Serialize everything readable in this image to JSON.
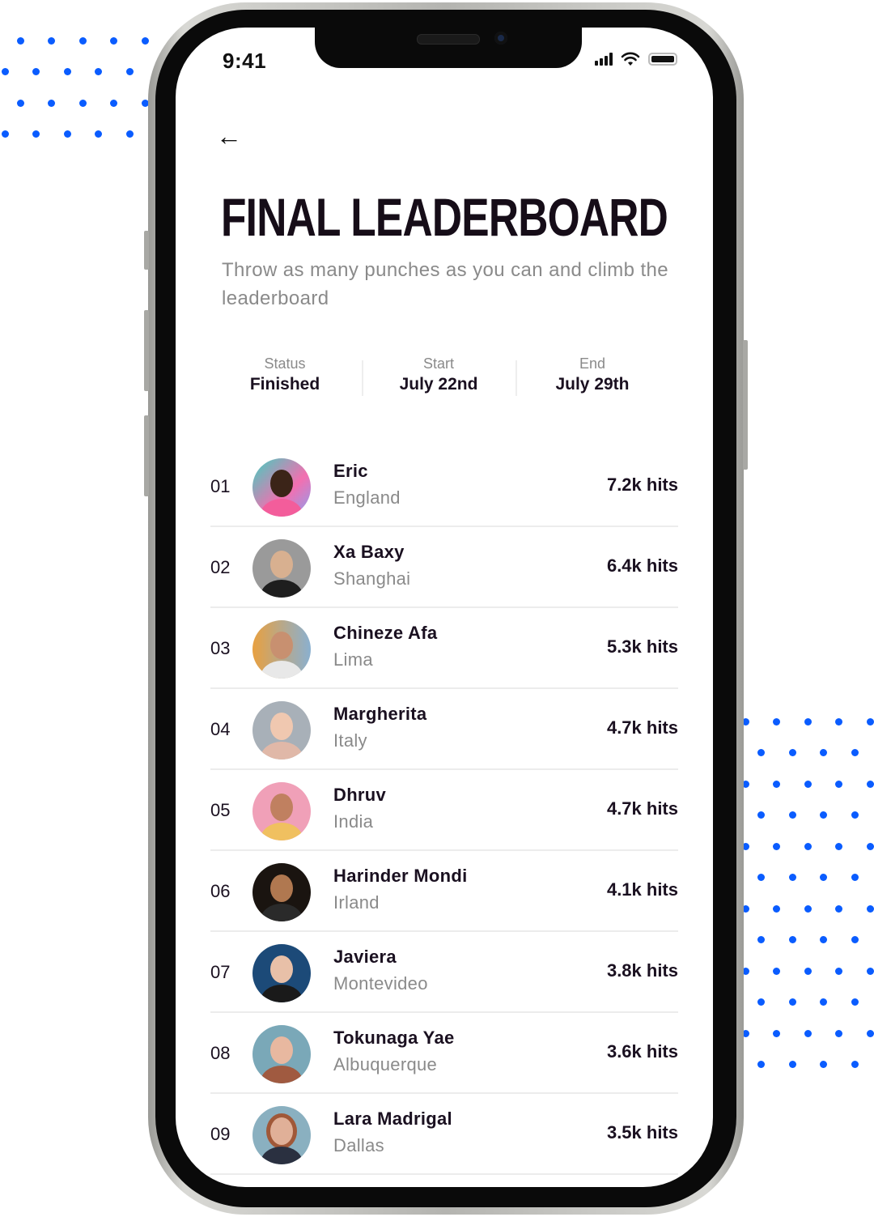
{
  "status_bar": {
    "time": "9:41"
  },
  "header": {
    "back_icon": "arrow-left-icon",
    "title": "FINAL LEADERBOARD",
    "subtitle": "Throw as many punches as you can and climb the leaderboard"
  },
  "meta": [
    {
      "label": "Status",
      "value": "Finished"
    },
    {
      "label": "Start",
      "value": "July 22nd"
    },
    {
      "label": "End",
      "value": "July 29th"
    }
  ],
  "colors": {
    "accent_dots": "#0a5cff",
    "title": "#160d18",
    "muted_text": "#8a8a8a"
  },
  "leaderboard": [
    {
      "rank": "01",
      "name": "Eric",
      "location": "England",
      "hits": "7.2k hits"
    },
    {
      "rank": "02",
      "name": "Xa Baxy",
      "location": "Shanghai",
      "hits": "6.4k hits"
    },
    {
      "rank": "03",
      "name": "Chineze Afa",
      "location": "Lima",
      "hits": "5.3k hits"
    },
    {
      "rank": "04",
      "name": "Margherita",
      "location": "Italy",
      "hits": "4.7k hits"
    },
    {
      "rank": "05",
      "name": "Dhruv",
      "location": "India",
      "hits": "4.7k hits"
    },
    {
      "rank": "06",
      "name": "Harinder Mondi",
      "location": "Irland",
      "hits": "4.1k hits"
    },
    {
      "rank": "07",
      "name": "Javiera",
      "location": "Montevideo",
      "hits": "3.8k hits"
    },
    {
      "rank": "08",
      "name": "Tokunaga Yae",
      "location": "Albuquerque",
      "hits": "3.6k hits"
    },
    {
      "rank": "09",
      "name": "Lara Madrigal",
      "location": "Dallas",
      "hits": "3.5k hits"
    }
  ]
}
